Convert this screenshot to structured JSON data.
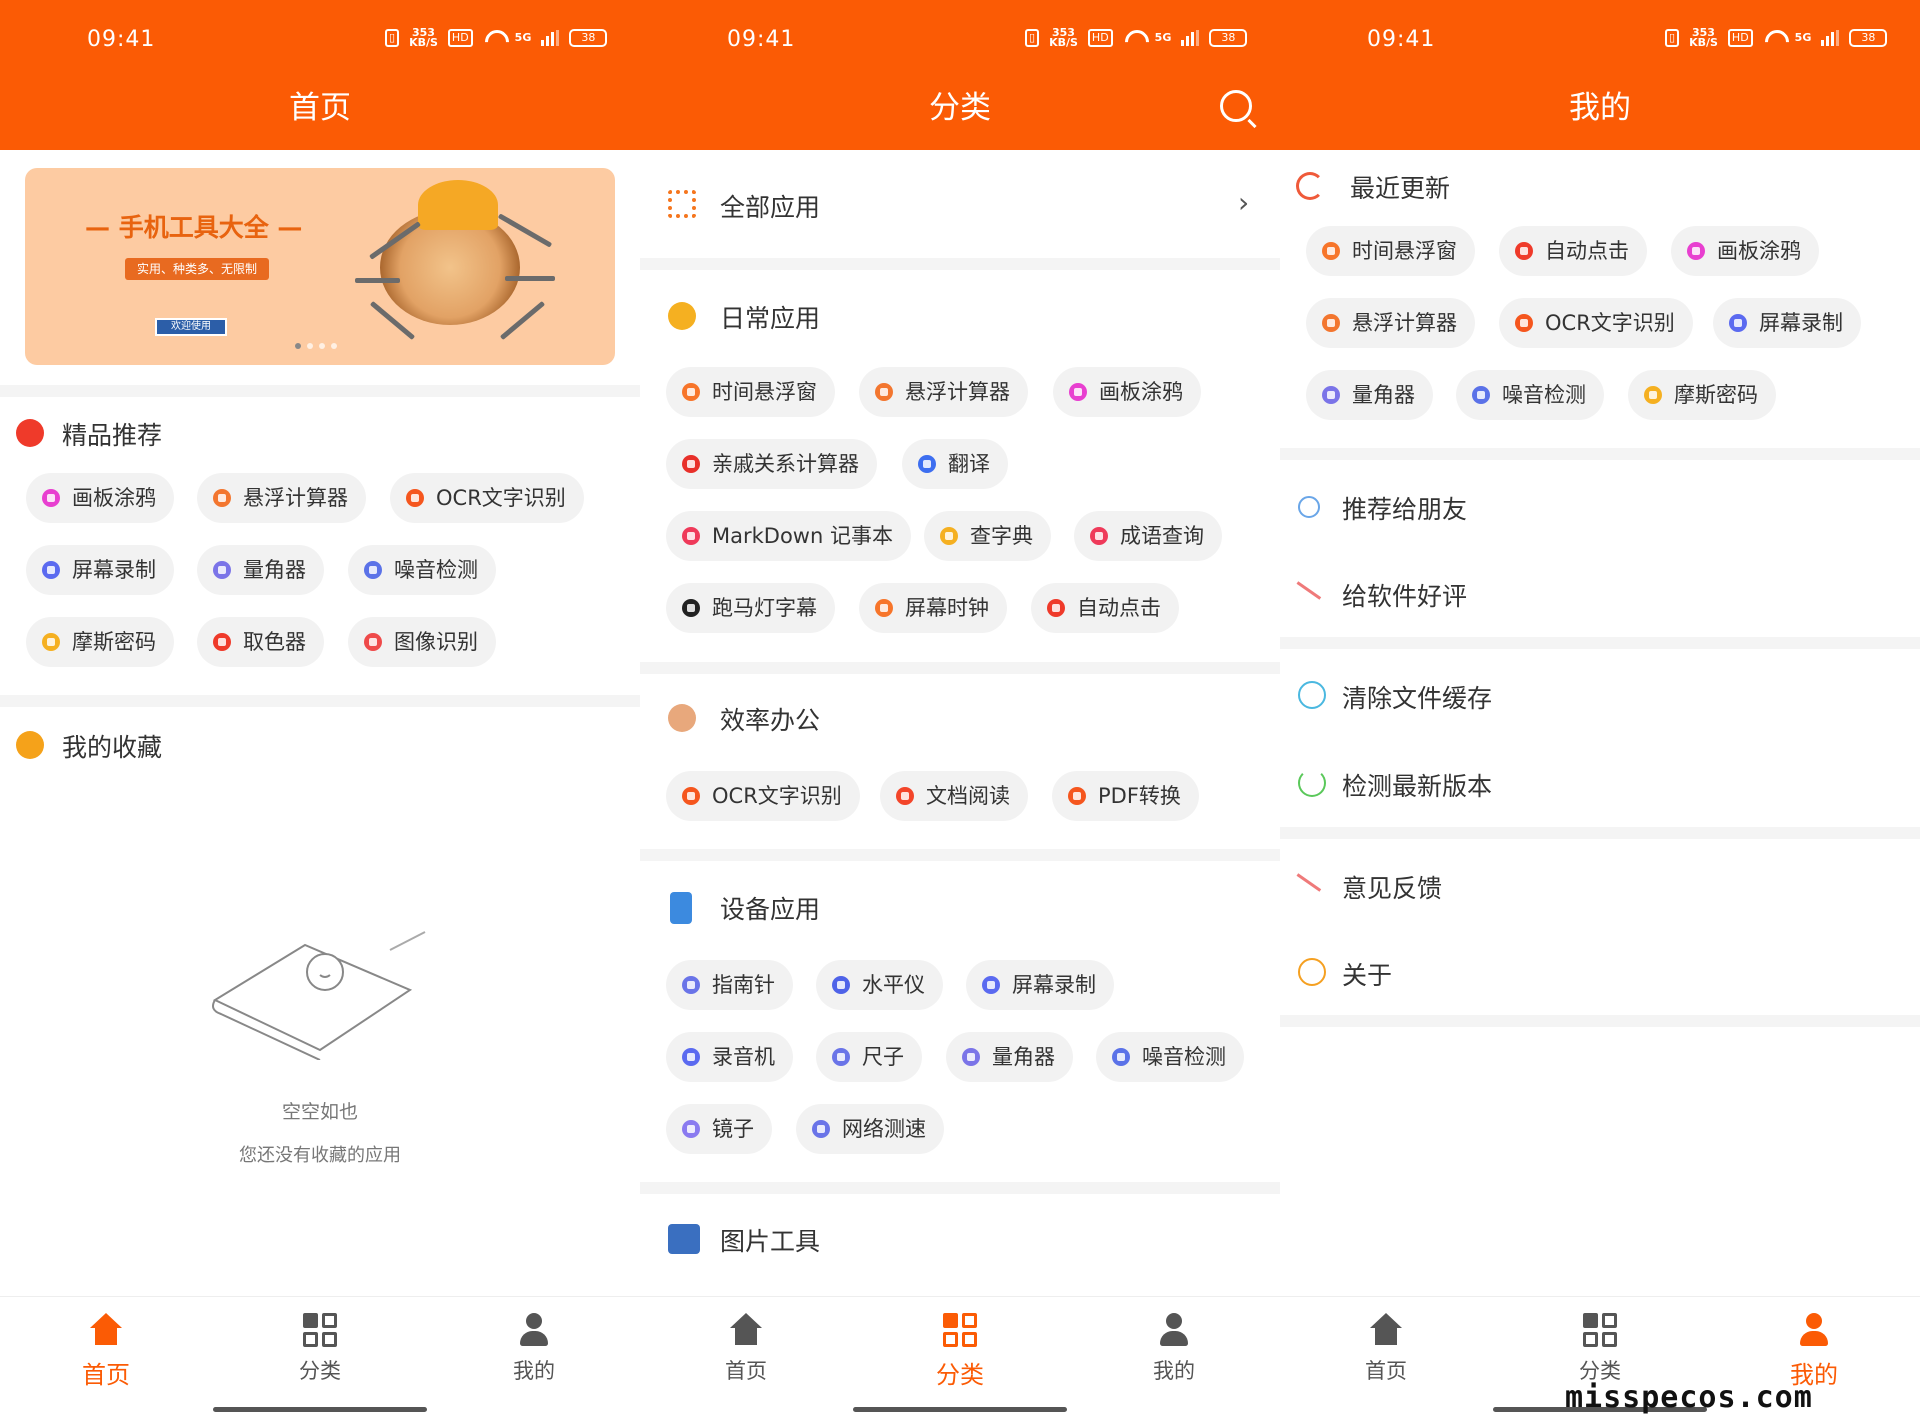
{
  "status": {
    "time": "09:41",
    "speed": "353\nKB/S",
    "hd": "HD",
    "net": "5G",
    "battery": "38"
  },
  "colors": {
    "accent": "#fb5b05"
  },
  "home": {
    "title": "首页",
    "banner": {
      "title": "— 手机工具大全 —",
      "subtitle": "实用、种类多、无限制",
      "button": "欢迎使用"
    },
    "featured": {
      "title": "精品推荐",
      "chips": [
        {
          "label": "画板涂鸦",
          "color": "#e83fd0"
        },
        {
          "label": "悬浮计算器",
          "color": "#f3762f"
        },
        {
          "label": "OCR文字识别",
          "color": "#f5561e"
        },
        {
          "label": "屏幕录制",
          "color": "#5b6af0"
        },
        {
          "label": "量角器",
          "color": "#7b74e8"
        },
        {
          "label": "噪音检测",
          "color": "#5b72e8"
        },
        {
          "label": "摩斯密码",
          "color": "#f5b021"
        },
        {
          "label": "取色器",
          "color": "#ef3a2a"
        },
        {
          "label": "图像识别",
          "color": "#ef4a4a"
        }
      ]
    },
    "favorites": {
      "title": "我的收藏",
      "empty_title": "空空如也",
      "empty_sub": "您还没有收藏的应用"
    }
  },
  "category": {
    "title": "分类",
    "all_apps": "全部应用",
    "chevron": "›",
    "sections": [
      {
        "title": "日常应用",
        "chips": [
          {
            "label": "时间悬浮窗",
            "color": "#f7752a"
          },
          {
            "label": "悬浮计算器",
            "color": "#f3762f"
          },
          {
            "label": "画板涂鸦",
            "color": "#e83fd0"
          },
          {
            "label": "亲戚关系计算器",
            "color": "#e8302a"
          },
          {
            "label": "翻译",
            "color": "#3d6ef0"
          },
          {
            "label": "MarkDown 记事本",
            "color": "#ef3a5a"
          },
          {
            "label": "查字典",
            "color": "#f5b021"
          },
          {
            "label": "成语查询",
            "color": "#ef3a5a"
          },
          {
            "label": "跑马灯字幕",
            "color": "#222222"
          },
          {
            "label": "屏幕时钟",
            "color": "#f7752a"
          },
          {
            "label": "自动点击",
            "color": "#ef3a2a"
          }
        ]
      },
      {
        "title": "效率办公",
        "chips": [
          {
            "label": "OCR文字识别",
            "color": "#f5561e"
          },
          {
            "label": "文档阅读",
            "color": "#f3452a"
          },
          {
            "label": "PDF转换",
            "color": "#f5561e"
          }
        ]
      },
      {
        "title": "设备应用",
        "chips": [
          {
            "label": "指南针",
            "color": "#6a74e8"
          },
          {
            "label": "水平仪",
            "color": "#4f63e8"
          },
          {
            "label": "屏幕录制",
            "color": "#5b6af0"
          },
          {
            "label": "录音机",
            "color": "#5b6af0"
          },
          {
            "label": "尺子",
            "color": "#6a74e8"
          },
          {
            "label": "量角器",
            "color": "#7b74e8"
          },
          {
            "label": "噪音检测",
            "color": "#5b72e8"
          },
          {
            "label": "镜子",
            "color": "#8a7af0"
          },
          {
            "label": "网络测速",
            "color": "#6a74e8"
          }
        ]
      },
      {
        "title": "图片工具",
        "chips": []
      }
    ]
  },
  "mine": {
    "title": "我的",
    "recent": {
      "title": "最近更新",
      "chips": [
        {
          "label": "时间悬浮窗",
          "color": "#f7752a"
        },
        {
          "label": "自动点击",
          "color": "#ef3a2a"
        },
        {
          "label": "画板涂鸦",
          "color": "#e83fd0"
        },
        {
          "label": "悬浮计算器",
          "color": "#f3762f"
        },
        {
          "label": "OCR文字识别",
          "color": "#f5561e"
        },
        {
          "label": "屏幕录制",
          "color": "#5b6af0"
        },
        {
          "label": "量角器",
          "color": "#7b74e8"
        },
        {
          "label": "噪音检测",
          "color": "#5b72e8"
        },
        {
          "label": "摩斯密码",
          "color": "#f5b021"
        }
      ]
    },
    "menu": [
      {
        "label": "推荐给朋友",
        "icon": "share-icon"
      },
      {
        "label": "给软件好评",
        "icon": "pencil-icon"
      },
      {
        "label": "清除文件缓存",
        "icon": "clear-icon"
      },
      {
        "label": "检测最新版本",
        "icon": "refresh-icon"
      },
      {
        "label": "意见反馈",
        "icon": "pencil-icon"
      },
      {
        "label": "关于",
        "icon": "info-icon"
      }
    ]
  },
  "tabs": [
    "首页",
    "分类",
    "我的"
  ],
  "watermark": "misspecos.com"
}
